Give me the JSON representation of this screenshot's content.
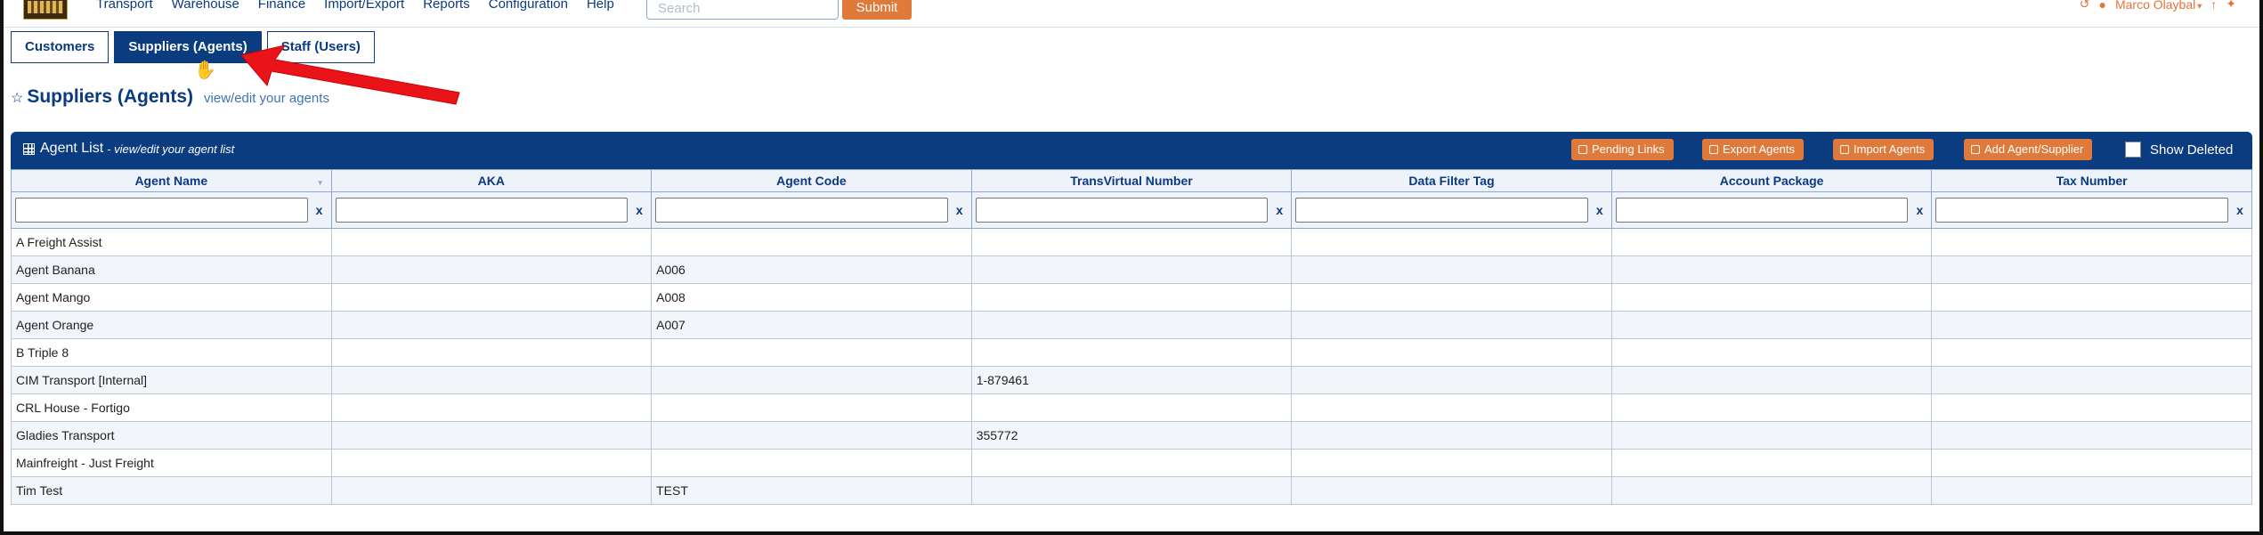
{
  "nav": {
    "items": [
      "Transport",
      "Warehouse",
      "Finance",
      "Import/Export",
      "Reports",
      "Configuration",
      "Help"
    ],
    "search_placeholder": "Search",
    "submit_label": "Submit",
    "user_name": "Marco Olaybal"
  },
  "tabs": [
    "Customers",
    "Suppliers (Agents)",
    "Staff (Users)"
  ],
  "active_tab": "Suppliers (Agents)",
  "page": {
    "title": "Suppliers (Agents)",
    "subtitle": "view/edit your agents"
  },
  "panel": {
    "title": "Agent List",
    "subtitle": "- view/edit your agent list",
    "buttons": [
      "Pending Links",
      "Export Agents",
      "Import Agents",
      "Add Agent/Supplier"
    ],
    "show_deleted_label": "Show Deleted"
  },
  "table": {
    "columns": [
      "Agent Name",
      "AKA",
      "Agent Code",
      "TransVirtual Number",
      "Data Filter Tag",
      "Account Package",
      "Tax Number"
    ],
    "clear_label": "x",
    "rows": [
      [
        "A Freight Assist",
        "",
        "",
        "",
        "",
        "",
        ""
      ],
      [
        "Agent Banana",
        "",
        "A006",
        "",
        "",
        "",
        ""
      ],
      [
        "Agent Mango",
        "",
        "A008",
        "",
        "",
        "",
        ""
      ],
      [
        "Agent Orange",
        "",
        "A007",
        "",
        "",
        "",
        ""
      ],
      [
        "B Triple 8",
        "",
        "",
        "",
        "",
        "",
        ""
      ],
      [
        "CIM Transport [Internal]",
        "",
        "",
        "1-879461",
        "",
        "",
        ""
      ],
      [
        "CRL House - Fortigo",
        "",
        "",
        "",
        "",
        "",
        ""
      ],
      [
        "Gladies Transport",
        "",
        "",
        "355772",
        "",
        "",
        ""
      ],
      [
        "Mainfreight - Just Freight",
        "",
        "",
        "",
        "",
        "",
        ""
      ],
      [
        "Tim Test",
        "",
        "TEST",
        "",
        "",
        "",
        ""
      ]
    ]
  },
  "colors": {
    "brand": "#0b3c80",
    "accent": "#e07a3a",
    "annotation_arrow": "#e8141a"
  }
}
